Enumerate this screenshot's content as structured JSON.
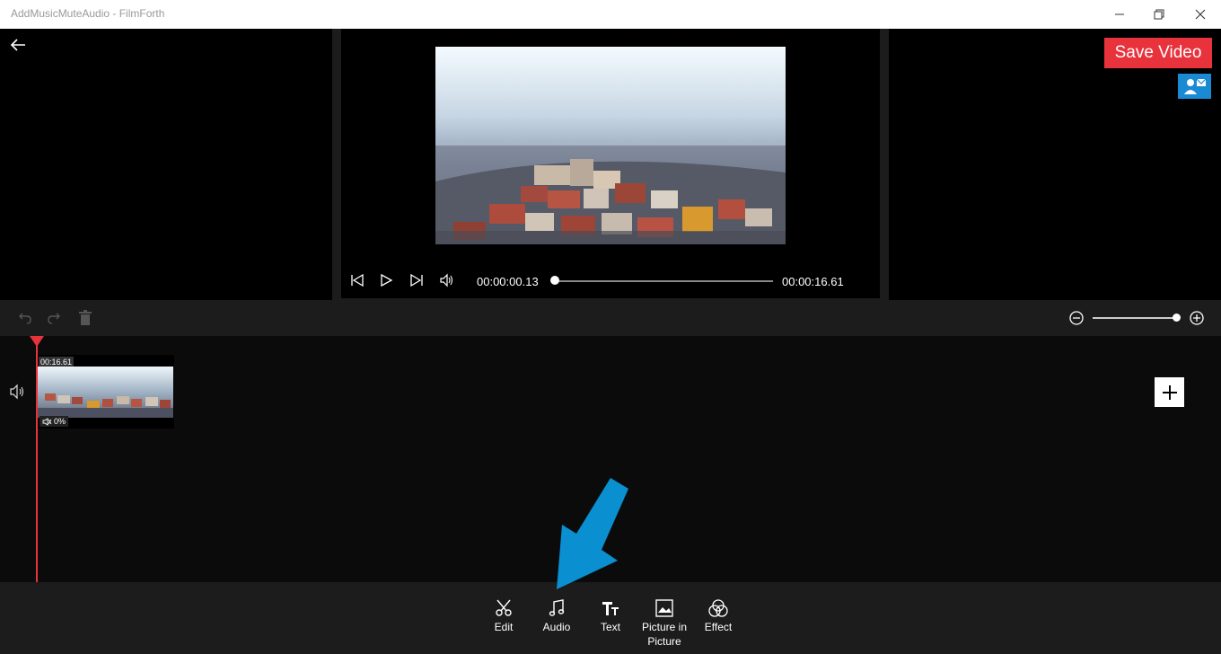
{
  "window": {
    "title": "AddMusicMuteAudio - FilmForth"
  },
  "header": {
    "save_label": "Save Video"
  },
  "player": {
    "current_time": "00:00:00.13",
    "total_time": "00:00:16.61",
    "progress_fraction": 0.008
  },
  "timeline": {
    "clip": {
      "duration": "00:16.61",
      "volume": "0%"
    }
  },
  "tools": [
    {
      "label": "Edit",
      "icon": "scissors-icon"
    },
    {
      "label": "Audio",
      "icon": "music-note-icon"
    },
    {
      "label": "Text",
      "icon": "text-icon"
    },
    {
      "label": "Picture in Picture",
      "icon": "picture-icon"
    },
    {
      "label": "Effect",
      "icon": "effect-icon"
    }
  ],
  "colors": {
    "accent_red": "#e8323c",
    "contact_blue": "#1a8ad4",
    "arrow_blue": "#0a8fd0"
  }
}
